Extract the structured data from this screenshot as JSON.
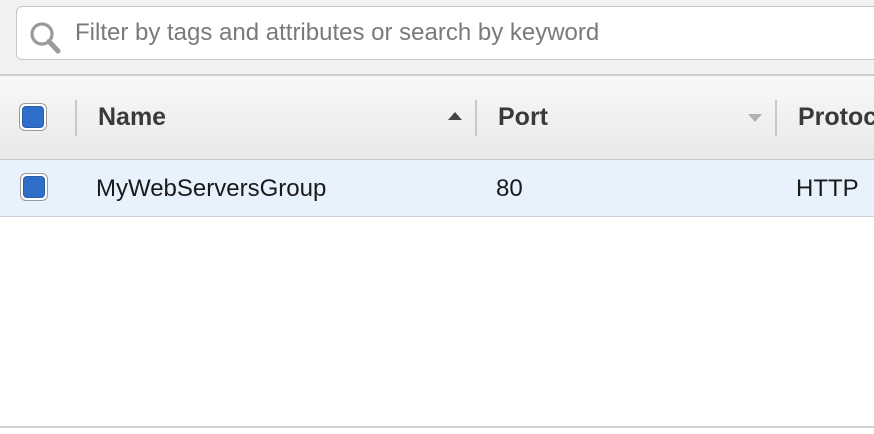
{
  "filter": {
    "placeholder": "Filter by tags and attributes or search by keyword",
    "value": ""
  },
  "columns": [
    {
      "label": "Name",
      "sort": "ascending"
    },
    {
      "label": "Port",
      "sort": "menu"
    },
    {
      "label": "Protocol",
      "sort": "none"
    }
  ],
  "rows": [
    {
      "selected": true,
      "name": "MyWebServersGroup",
      "port": "80",
      "protocol": "HTTP"
    }
  ],
  "icons": {
    "search": "search-icon",
    "sort_ascending": "sort-ascending-icon",
    "sort_menu": "dropdown-caret-icon"
  },
  "colors": {
    "checkbox_fill": "#2f6fc9",
    "row_selected_bg": "#e8f2fd",
    "header_bg": "#eeeeee"
  }
}
